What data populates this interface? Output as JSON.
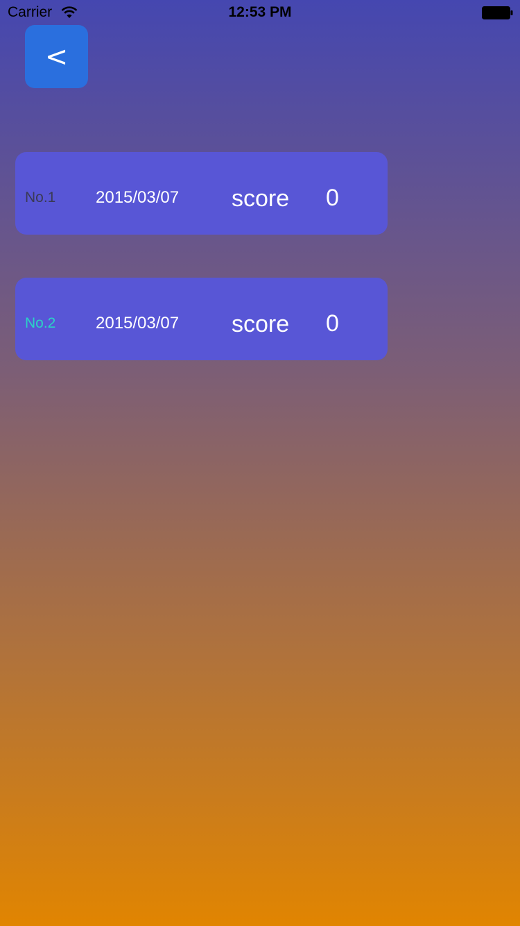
{
  "status_bar": {
    "carrier": "Carrier",
    "time": "12:53 PM",
    "icons": [
      "wifi-icon",
      "battery-icon"
    ]
  },
  "nav": {
    "back_label": "<"
  },
  "records": [
    {
      "rank": "No.1",
      "date": "2015/03/07",
      "score_label": "score",
      "score": "0",
      "rank_color": "#3a3a55"
    },
    {
      "rank": "No.2",
      "date": "2015/03/07",
      "score_label": "score",
      "score": "0",
      "rank_color": "#2bd3c5"
    }
  ],
  "colors": {
    "gradient_top": "#4547b0",
    "gradient_bottom": "#e18501",
    "card": "#5856d6",
    "back_button": "#2a6fde"
  }
}
